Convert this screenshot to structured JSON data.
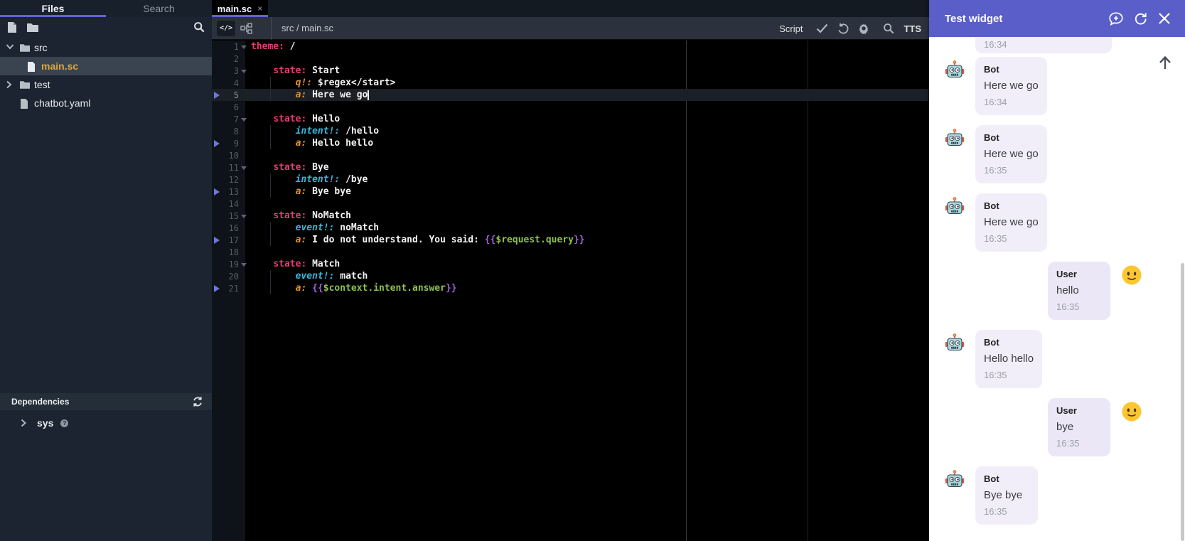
{
  "sidebar": {
    "tabs": [
      {
        "label": "Files",
        "active": true
      },
      {
        "label": "Search",
        "active": false
      }
    ],
    "toolbar_icons": [
      "new-file-icon",
      "new-folder-icon",
      "search-icon"
    ],
    "tree": [
      {
        "type": "folder",
        "label": "src",
        "expanded": true,
        "depth": 0,
        "selected": false
      },
      {
        "type": "file",
        "label": "main.sc",
        "depth": 1,
        "selected": true
      },
      {
        "type": "folder",
        "label": "test",
        "expanded": false,
        "depth": 0,
        "selected": false
      },
      {
        "type": "file",
        "label": "chatbot.yaml",
        "depth": 0,
        "selected": false
      }
    ],
    "dependencies": {
      "title": "Dependencies",
      "items": [
        {
          "label": "sys",
          "badge": "?"
        }
      ]
    }
  },
  "editor": {
    "tab": {
      "label": "main.sc",
      "close": "×"
    },
    "breadcrumb": "src / main.sc",
    "toolbar": {
      "mode_label": "Script",
      "tts_label": "TTS",
      "icons": [
        "check-icon",
        "undo-icon",
        "gear-icon",
        "search-icon"
      ]
    },
    "code": {
      "lines": [
        {
          "n": 1,
          "fold": true,
          "tokens": [
            [
              "theme:",
              "k"
            ],
            [
              " /",
              "p"
            ]
          ]
        },
        {
          "n": 2,
          "tokens": []
        },
        {
          "n": 3,
          "fold": true,
          "tokens": [
            [
              "    ",
              "p"
            ],
            [
              "state:",
              "k"
            ],
            [
              " Start",
              "p"
            ]
          ]
        },
        {
          "n": 4,
          "tokens": [
            [
              "        ",
              "p"
            ],
            [
              "q!:",
              "a"
            ],
            [
              " $regex</start>",
              "p"
            ]
          ]
        },
        {
          "n": 5,
          "arrow": true,
          "current": true,
          "cursor": true,
          "tokens": [
            [
              "        ",
              "p"
            ],
            [
              "a:",
              "a"
            ],
            [
              " Here we go",
              "p"
            ]
          ]
        },
        {
          "n": 6,
          "tokens": []
        },
        {
          "n": 7,
          "fold": true,
          "tokens": [
            [
              "    ",
              "p"
            ],
            [
              "state:",
              "k"
            ],
            [
              " Hello",
              "p"
            ]
          ]
        },
        {
          "n": 8,
          "tokens": [
            [
              "        ",
              "p"
            ],
            [
              "intent!:",
              "i"
            ],
            [
              " /hello",
              "p"
            ]
          ]
        },
        {
          "n": 9,
          "arrow": true,
          "tokens": [
            [
              "        ",
              "p"
            ],
            [
              "a:",
              "a"
            ],
            [
              " Hello hello",
              "p"
            ]
          ]
        },
        {
          "n": 10,
          "tokens": []
        },
        {
          "n": 11,
          "fold": true,
          "tokens": [
            [
              "    ",
              "p"
            ],
            [
              "state:",
              "k"
            ],
            [
              " Bye",
              "p"
            ]
          ]
        },
        {
          "n": 12,
          "tokens": [
            [
              "        ",
              "p"
            ],
            [
              "intent!:",
              "i"
            ],
            [
              " /bye",
              "p"
            ]
          ]
        },
        {
          "n": 13,
          "arrow": true,
          "tokens": [
            [
              "        ",
              "p"
            ],
            [
              "a:",
              "a"
            ],
            [
              " Bye bye",
              "p"
            ]
          ]
        },
        {
          "n": 14,
          "tokens": []
        },
        {
          "n": 15,
          "fold": true,
          "tokens": [
            [
              "    ",
              "p"
            ],
            [
              "state:",
              "k"
            ],
            [
              " NoMatch",
              "p"
            ]
          ]
        },
        {
          "n": 16,
          "tokens": [
            [
              "        ",
              "p"
            ],
            [
              "event!:",
              "i"
            ],
            [
              " noMatch",
              "p"
            ]
          ]
        },
        {
          "n": 17,
          "arrow": true,
          "tokens": [
            [
              "        ",
              "p"
            ],
            [
              "a:",
              "a"
            ],
            [
              " I do not understand. You said: ",
              "p"
            ],
            [
              "{{",
              "b"
            ],
            [
              "$request.query",
              "v"
            ],
            [
              "}}",
              "b"
            ]
          ]
        },
        {
          "n": 18,
          "tokens": []
        },
        {
          "n": 19,
          "fold": true,
          "tokens": [
            [
              "    ",
              "p"
            ],
            [
              "state:",
              "k"
            ],
            [
              " Match",
              "p"
            ]
          ]
        },
        {
          "n": 20,
          "tokens": [
            [
              "        ",
              "p"
            ],
            [
              "event!:",
              "i"
            ],
            [
              " match",
              "p"
            ]
          ]
        },
        {
          "n": 21,
          "arrow": true,
          "tokens": [
            [
              "        ",
              "p"
            ],
            [
              "a:",
              "a"
            ],
            [
              " ",
              "p"
            ],
            [
              "{{",
              "b"
            ],
            [
              "$context.intent.answer",
              "v"
            ],
            [
              "}}",
              "b"
            ]
          ]
        }
      ]
    }
  },
  "widget": {
    "title": "Test widget",
    "header_icons": [
      "comment-plus-icon",
      "refresh-icon",
      "close-icon"
    ],
    "messages": [
      {
        "kind": "clipped",
        "time": "16:34"
      },
      {
        "kind": "bot",
        "name": "Bot",
        "text": "Here we go",
        "time": "16:34"
      },
      {
        "kind": "bot",
        "name": "Bot",
        "text": "Here we go",
        "time": "16:35"
      },
      {
        "kind": "bot",
        "name": "Bot",
        "text": "Here we go",
        "time": "16:35"
      },
      {
        "kind": "user",
        "name": "User",
        "text": "hello",
        "time": "16:35"
      },
      {
        "kind": "bot",
        "name": "Bot",
        "text": "Hello hello",
        "time": "16:35"
      },
      {
        "kind": "user",
        "name": "User",
        "text": "bye",
        "time": "16:35"
      },
      {
        "kind": "bot",
        "name": "Bot",
        "text": "Bye bye",
        "time": "16:35"
      }
    ]
  },
  "colors": {
    "accent_purple": "#5f64d3",
    "widget_header": "#5a5ec9",
    "selected_file": "#dca73e",
    "syntax_key": "#e93a73",
    "syntax_attr": "#e0912f",
    "syntax_intent": "#35b8da",
    "syntax_brace": "#9d5fd3",
    "syntax_var": "#8fc04c",
    "bot_bubble": "#f1eefa",
    "user_bubble": "#ece7f7"
  }
}
